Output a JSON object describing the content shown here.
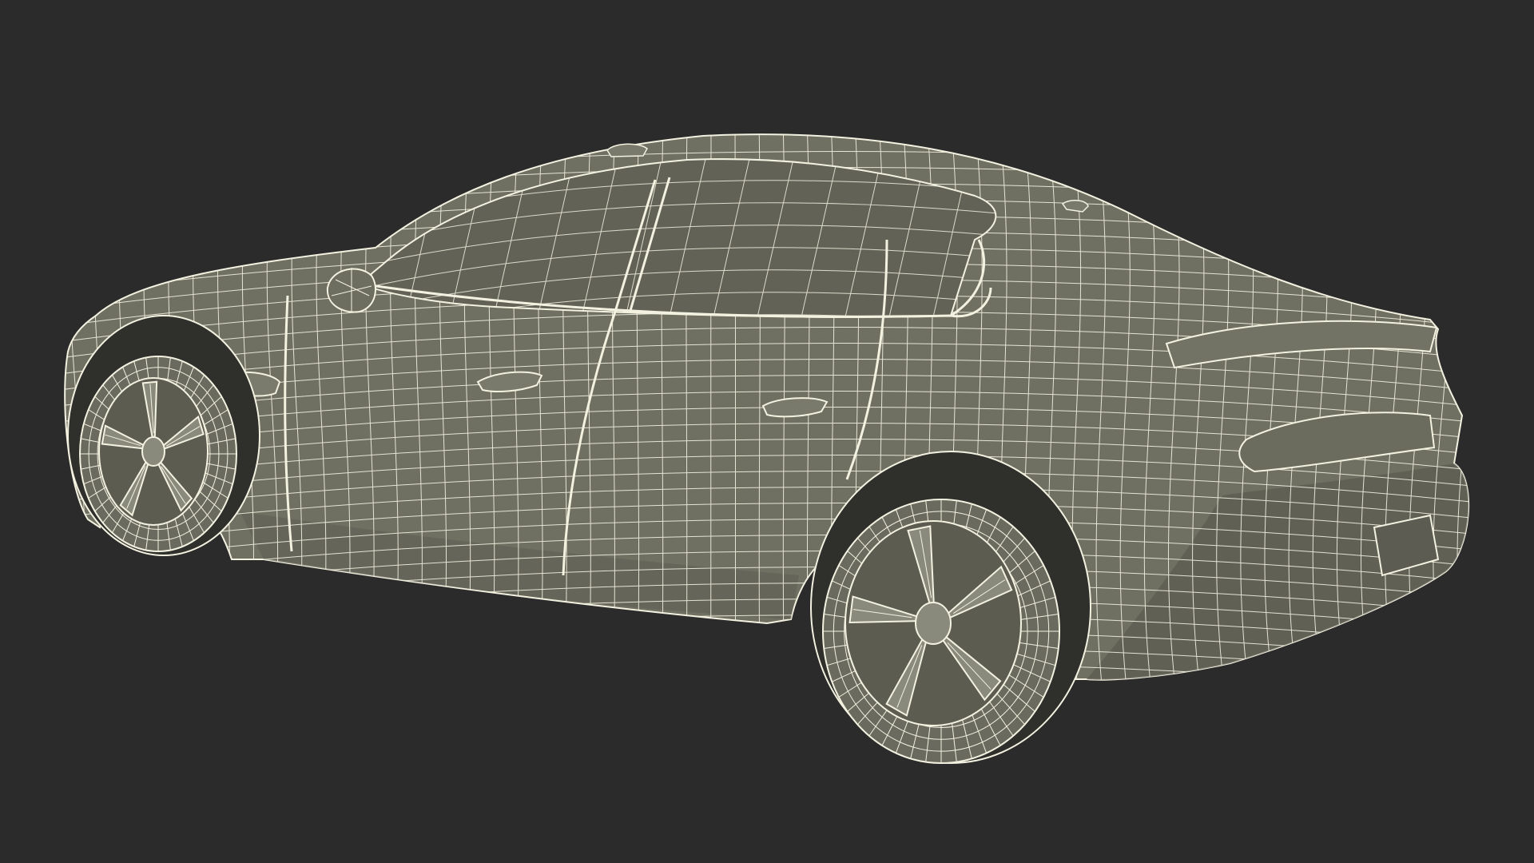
{
  "scene": {
    "subject": "sedan-wireframe",
    "view": "rear-three-quarter",
    "background_color": "#2b2b2b",
    "body_color": "#6f6f62",
    "body_shadow_color": "#5a5a50",
    "glass_color": "#5f5f54",
    "wire_color": "#f3f1e0",
    "tire_color": "#6a6a5e",
    "rim_color": "#8a8a7c"
  }
}
